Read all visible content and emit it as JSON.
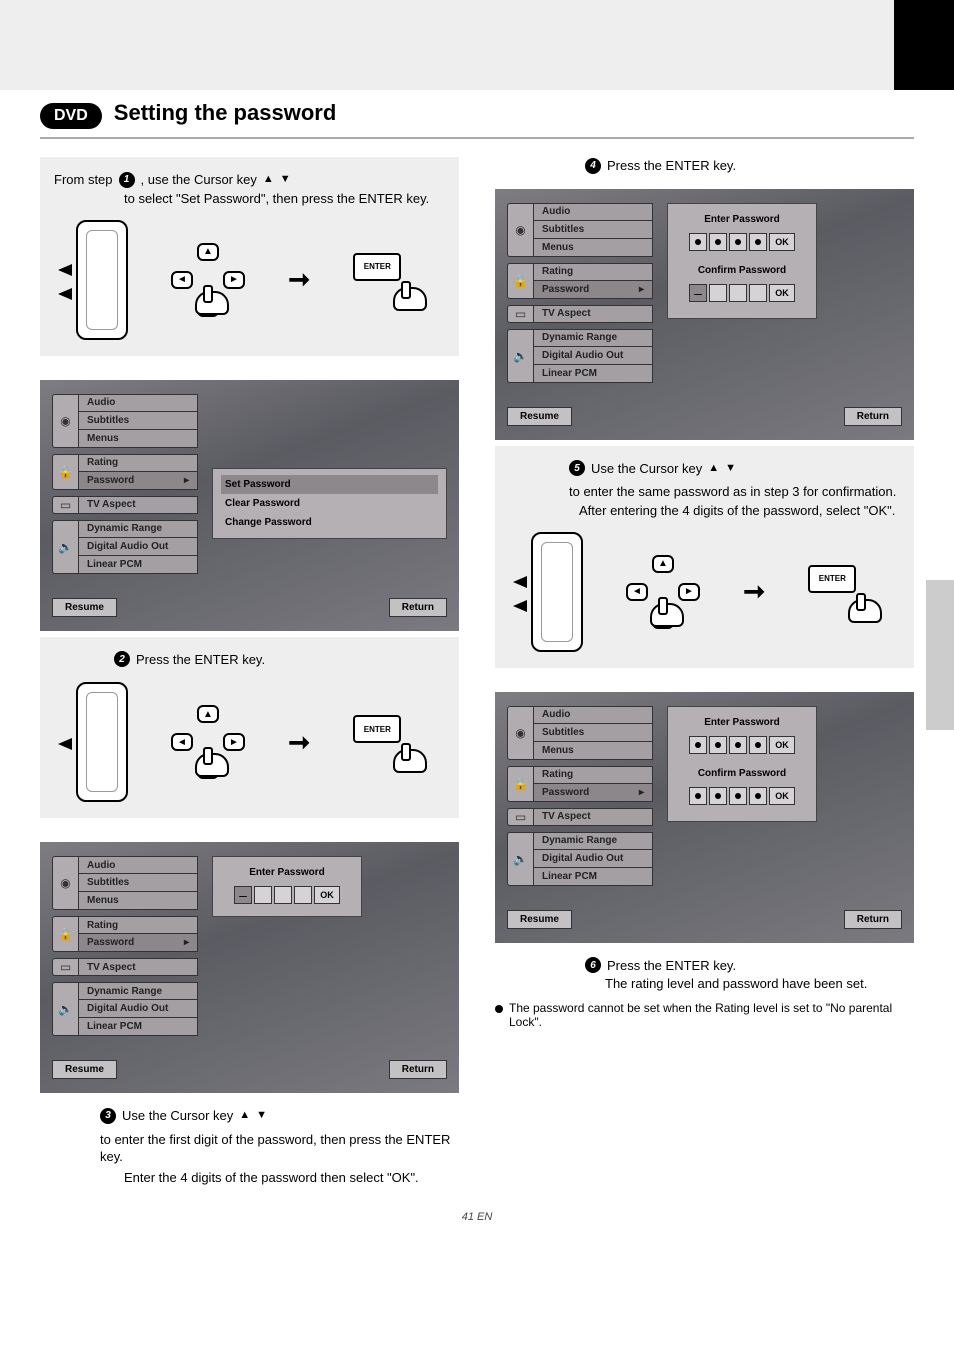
{
  "header": {
    "pill": "DVD",
    "title": "Setting the password"
  },
  "steps": {
    "s1a": "From step",
    "s1b": ", use the Cursor key",
    "s1c": "to select \"Set Password\", then press the ENTER key.",
    "s2": "Press the ENTER key.",
    "s3a": "Use the Cursor key",
    "s3b": "to enter the first digit of the password, then press the ENTER key.",
    "s3c": "Enter the 4 digits of the password then select \"OK\".",
    "s4": "Press the ENTER key.",
    "s5a": "Use the Cursor key",
    "s5b": "to enter the same password as in step 3 for confirmation.",
    "s5c": "After entering the 4 digits of the password, select \"OK\".",
    "s6a": "Press the ENTER key.",
    "s6b": "The rating level and password have been set.",
    "note": "The password cannot be set when the Rating level is set to \"No parental Lock\"."
  },
  "menu": {
    "group1": [
      "Audio",
      "Subtitles",
      "Menus"
    ],
    "group2": [
      "Rating",
      "Password"
    ],
    "group3": [
      "TV Aspect"
    ],
    "group4": [
      "Dynamic Range",
      "Digital Audio Out",
      "Linear PCM"
    ],
    "passwordOpts": [
      "Set Password",
      "Clear Password",
      "Change Password"
    ],
    "enterPw": "Enter Password",
    "confirmPw": "Confirm Password",
    "ok": "OK",
    "resume": "Resume",
    "return": "Return",
    "enterBtn": "ENTER"
  },
  "page": {
    "num": "41 EN"
  }
}
